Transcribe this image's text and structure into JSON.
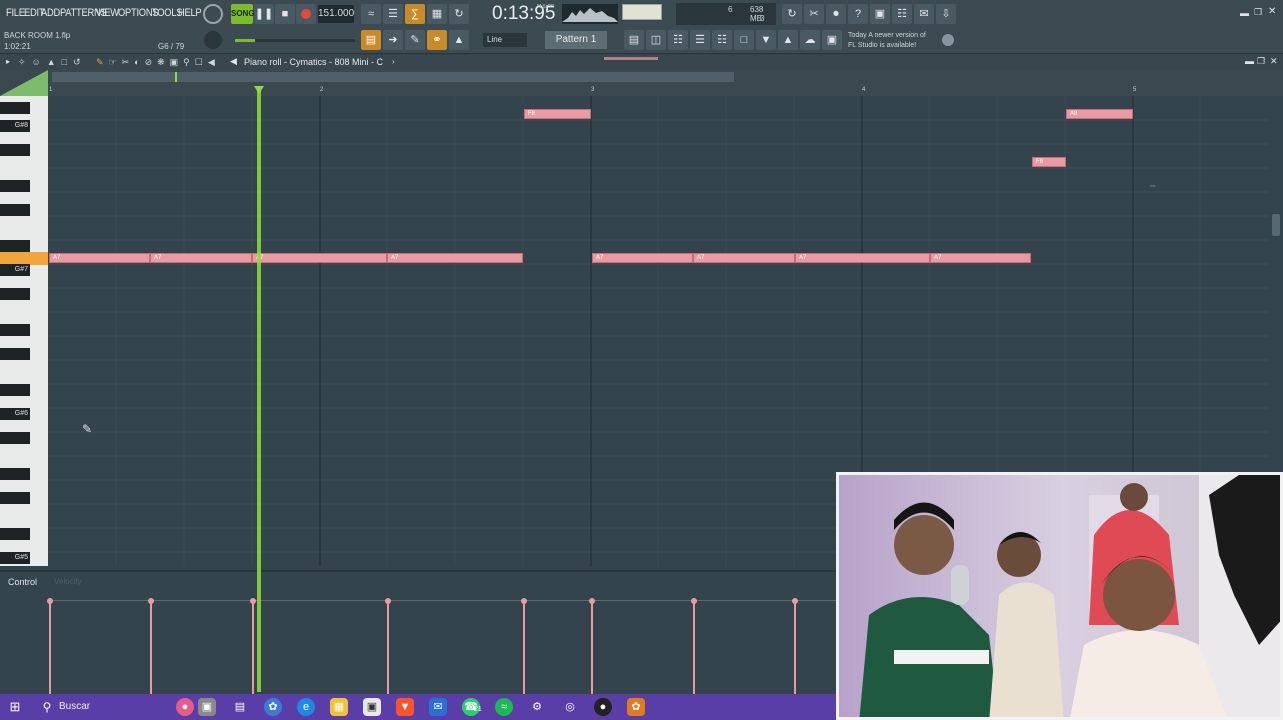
{
  "menu": [
    "FILE",
    "EDIT",
    "ADD",
    "PATTERNS",
    "VIEW",
    "OPTIONS",
    "TOOLS",
    "HELP"
  ],
  "project": {
    "file": "BACK ROOM 1.flp",
    "time": "1:02:21",
    "position": "G6 / 79"
  },
  "transport": {
    "tempo": "151.000",
    "song_pat": "SONG",
    "clock": "0:13:95",
    "clock_unit": "M:S:CS"
  },
  "cpu": {
    "mem": "638 MB",
    "voices": "6",
    "polyphony": "3"
  },
  "snap": "Line",
  "pattern": "Pattern 1",
  "news": {
    "line1": "Today  A newer version of",
    "line2": "FL Studio is available!"
  },
  "pianoroll": {
    "title": "Piano roll - Cymatics - 808 Mini - C"
  },
  "bars": [
    "1",
    "2",
    "3",
    "4",
    "5"
  ],
  "keys": [
    "G#8",
    "G#7",
    "G#6",
    "G#5"
  ],
  "notes": [
    {
      "label": "F8"
    },
    {
      "label": "A8"
    },
    {
      "label": "F8"
    },
    {
      "label": "A7"
    },
    {
      "label": "A7"
    },
    {
      "label": "A7"
    },
    {
      "label": "A7"
    },
    {
      "label": "A7"
    },
    {
      "label": "A7"
    },
    {
      "label": "A7"
    },
    {
      "label": "A7"
    }
  ],
  "control": {
    "label": "Control",
    "sub": "Velocity"
  },
  "taskbar": {
    "search": "Buscar",
    "whatsapp_badge": "21"
  },
  "colors": {
    "note": "#e99aa2",
    "playhead": "#8adf3c",
    "taskbar": "#5a3ea8",
    "accent": "#c98b27"
  }
}
